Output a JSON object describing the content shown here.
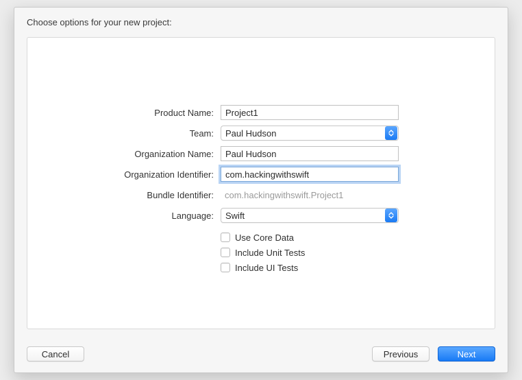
{
  "title": "Choose options for your new project:",
  "labels": {
    "product_name": "Product Name:",
    "team": "Team:",
    "org_name": "Organization Name:",
    "org_identifier": "Organization Identifier:",
    "bundle_identifier": "Bundle Identifier:",
    "language": "Language:"
  },
  "fields": {
    "product_name": "Project1",
    "team": "Paul Hudson",
    "org_name": "Paul Hudson",
    "org_identifier": "com.hackingwithswift",
    "bundle_identifier": "com.hackingwithswift.Project1",
    "language": "Swift"
  },
  "checkboxes": {
    "core_data": "Use Core Data",
    "unit_tests": "Include Unit Tests",
    "ui_tests": "Include UI Tests"
  },
  "buttons": {
    "cancel": "Cancel",
    "previous": "Previous",
    "next": "Next"
  }
}
